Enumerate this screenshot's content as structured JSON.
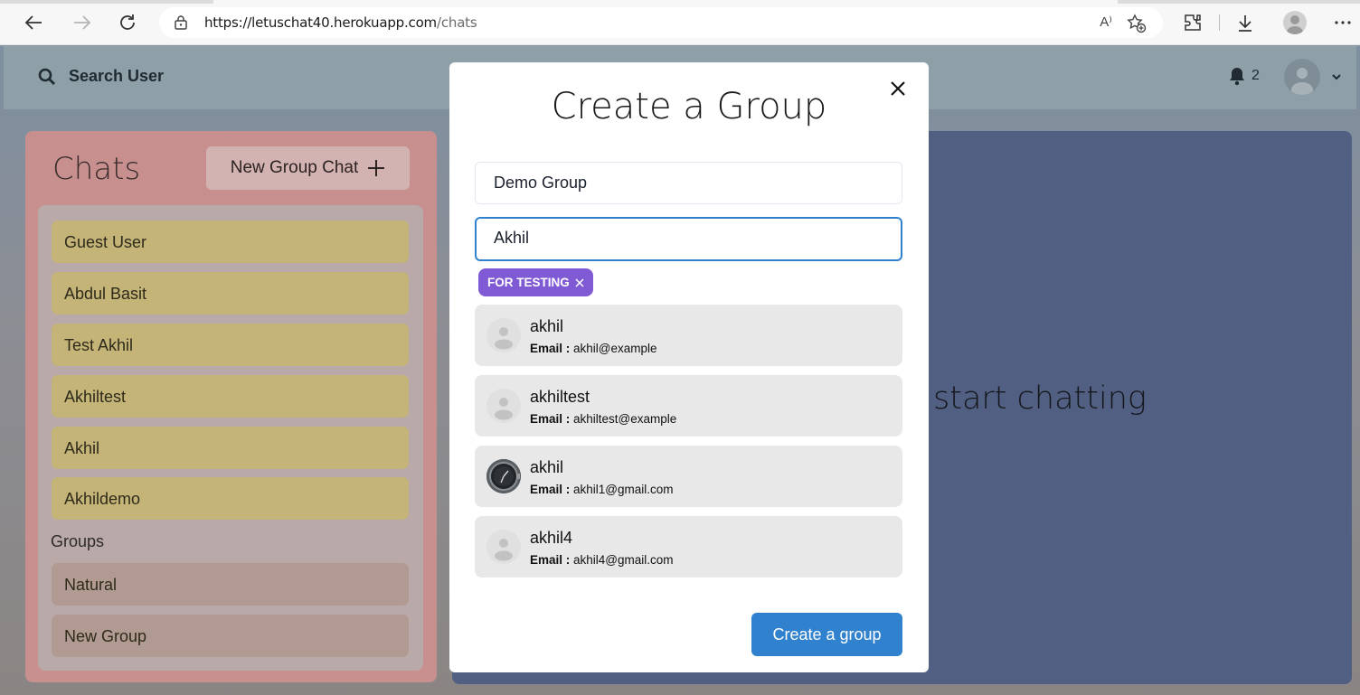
{
  "browser": {
    "url_host": "https://letuschat40.herokuapp.com",
    "url_path": "/chats",
    "read_aloud": "A⁾"
  },
  "app": {
    "search_label": "Search User",
    "notification_count": "2"
  },
  "chats": {
    "title": "Chats",
    "new_group_label": "New Group Chat",
    "items": [
      {
        "label": "Guest User"
      },
      {
        "label": "Abdul Basit"
      },
      {
        "label": "Test Akhil"
      },
      {
        "label": "Akhiltest"
      },
      {
        "label": "Akhil"
      },
      {
        "label": "Akhildemo"
      }
    ],
    "groups_label": "Groups",
    "groups": [
      {
        "label": "Natural"
      },
      {
        "label": "New Group"
      }
    ]
  },
  "main": {
    "placeholder": "start chatting"
  },
  "modal": {
    "title": "Create a Group",
    "group_name_value": "Demo Group",
    "search_value": "Akhil",
    "selected_tag": "FOR TESTING",
    "email_label": "Email :",
    "results": [
      {
        "name": "akhil",
        "email": "akhil@example",
        "avatar": "default-avatar"
      },
      {
        "name": "akhiltest",
        "email": "akhiltest@example",
        "avatar": "default-avatar"
      },
      {
        "name": "akhil",
        "email": "akhil1@gmail.com",
        "avatar": "watch-photo"
      },
      {
        "name": "akhil4",
        "email": "akhil4@gmail.com",
        "avatar": "default-avatar"
      }
    ],
    "submit_label": "Create a group"
  },
  "colors": {
    "accent": "#3182ce",
    "tag": "#805ad5",
    "chat_item": "#c4b478",
    "group_item": "#b19a92",
    "chat_panel": "#c88f8f",
    "chat_area": "#515f82"
  }
}
